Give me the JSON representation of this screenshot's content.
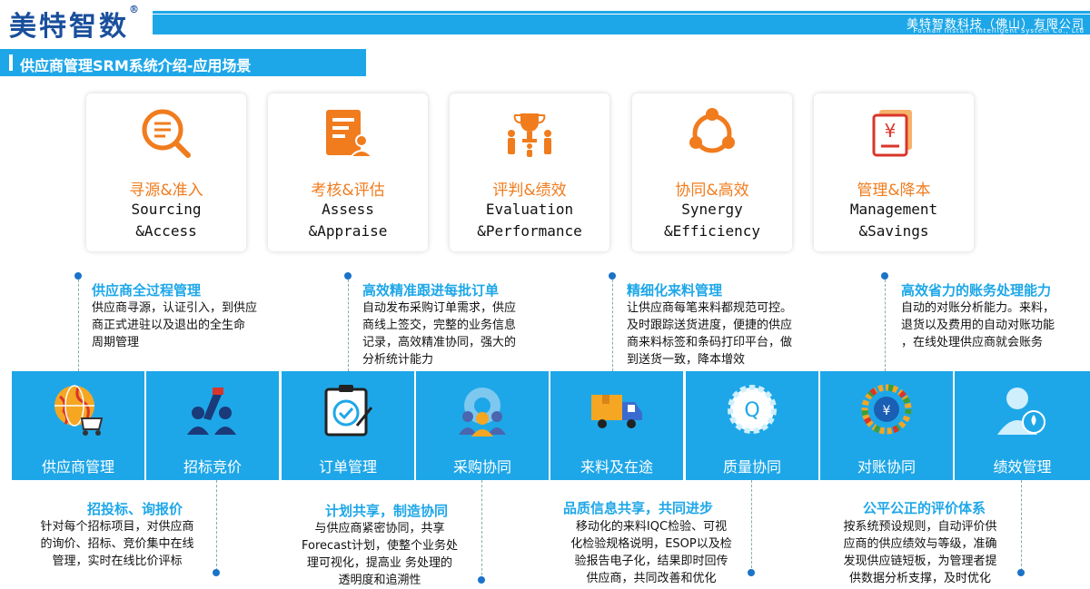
{
  "header": {
    "brand": "美特智数",
    "brand_mark": "®",
    "company_cn": "美特智数科技（佛山）有限公司",
    "company_en": "Foshan Instant Intelligent System Co., Ltd"
  },
  "page_title": "供应商管理SRM系统介绍-应用场景",
  "colors": {
    "accent": "#1ea7e8",
    "orange": "#f07c1e",
    "brand": "#1a4f9c"
  },
  "cards": [
    {
      "cn": "寻源&准入",
      "en1": "Sourcing",
      "en2": "&Access",
      "icon": "search-doc-icon"
    },
    {
      "cn": "考核&评估",
      "en1": "Assess",
      "en2": "&Appraise",
      "icon": "document-person-icon"
    },
    {
      "cn": "评判&绩效",
      "en1": "Evaluation",
      "en2": "&Performance",
      "icon": "trophy-people-icon"
    },
    {
      "cn": "协同&高效",
      "en1": "Synergy",
      "en2": "&Efficiency",
      "icon": "cycle-nodes-icon"
    },
    {
      "cn": "管理&降本",
      "en1": "Management",
      "en2": "&Savings",
      "icon": "yen-document-icon"
    }
  ],
  "top_annotations": [
    {
      "title": "供应商全过程管理",
      "lines": [
        "供应商寻源，认证引入，到供应",
        "商正式进驻以及退出的全生命",
        "周期管理"
      ]
    },
    {
      "title": "高效精准跟进每批订单",
      "lines": [
        "自动发布采购订单需求，供应",
        "商线上签交，完整的业务信息",
        "记录，高效精准协同，强大的",
        "分析统计能力"
      ]
    },
    {
      "title": "精细化来料管理",
      "lines": [
        "让供应商每笔来料都规范可控。",
        "及时跟踪送货进度，便捷的供应",
        "商来料标签和条码打印平台，做",
        "到送货一致，降本增效"
      ]
    },
    {
      "title": "高效省力的账务处理能力",
      "lines": [
        "自动的对账分析能力。来料，",
        "退货以及费用的自动对账功能",
        "，在线处理供应商就会账务"
      ]
    }
  ],
  "modules": [
    {
      "label": "供应商管理",
      "icon": "globe-cart-icon"
    },
    {
      "label": "招标竞价",
      "icon": "bidding-hand-icon"
    },
    {
      "label": "订单管理",
      "icon": "clipboard-check-icon"
    },
    {
      "label": "采购协同",
      "icon": "team-gear-icon"
    },
    {
      "label": "来料及在途",
      "icon": "delivery-truck-icon"
    },
    {
      "label": "质量协同",
      "icon": "quality-gear-icon"
    },
    {
      "label": "对账协同",
      "icon": "yen-dial-icon"
    },
    {
      "label": "绩效管理",
      "icon": "person-flower-icon"
    }
  ],
  "bottom_annotations": [
    {
      "title": "招投标、询报价",
      "lines": [
        "针对每个招标项目，对供应商",
        "的询价、招标、竞价集中在线",
        "管理，实时在线比价评标"
      ]
    },
    {
      "title": "计划共享，制造协同",
      "lines": [
        "与供应商紧密协同，共享",
        "Forecast计划，使整个业务处",
        "理可视化，提高业 务处理的",
        "透明度和追溯性"
      ]
    },
    {
      "title": "品质信息共享，共同进步",
      "lines": [
        "移动化的来料IQC检验、可视",
        "化检验规格说明，ESOP以及检",
        "验报告电子化，结果即时回传",
        "供应商，共同改善和优化"
      ]
    },
    {
      "title": "公平公正的评价体系",
      "lines": [
        "按系统预设规则，自动评价供",
        "应商的供应绩效与等级，准确",
        "发现供应链短板，为管理者提",
        "供数据分析支撑，及时优化"
      ]
    }
  ]
}
